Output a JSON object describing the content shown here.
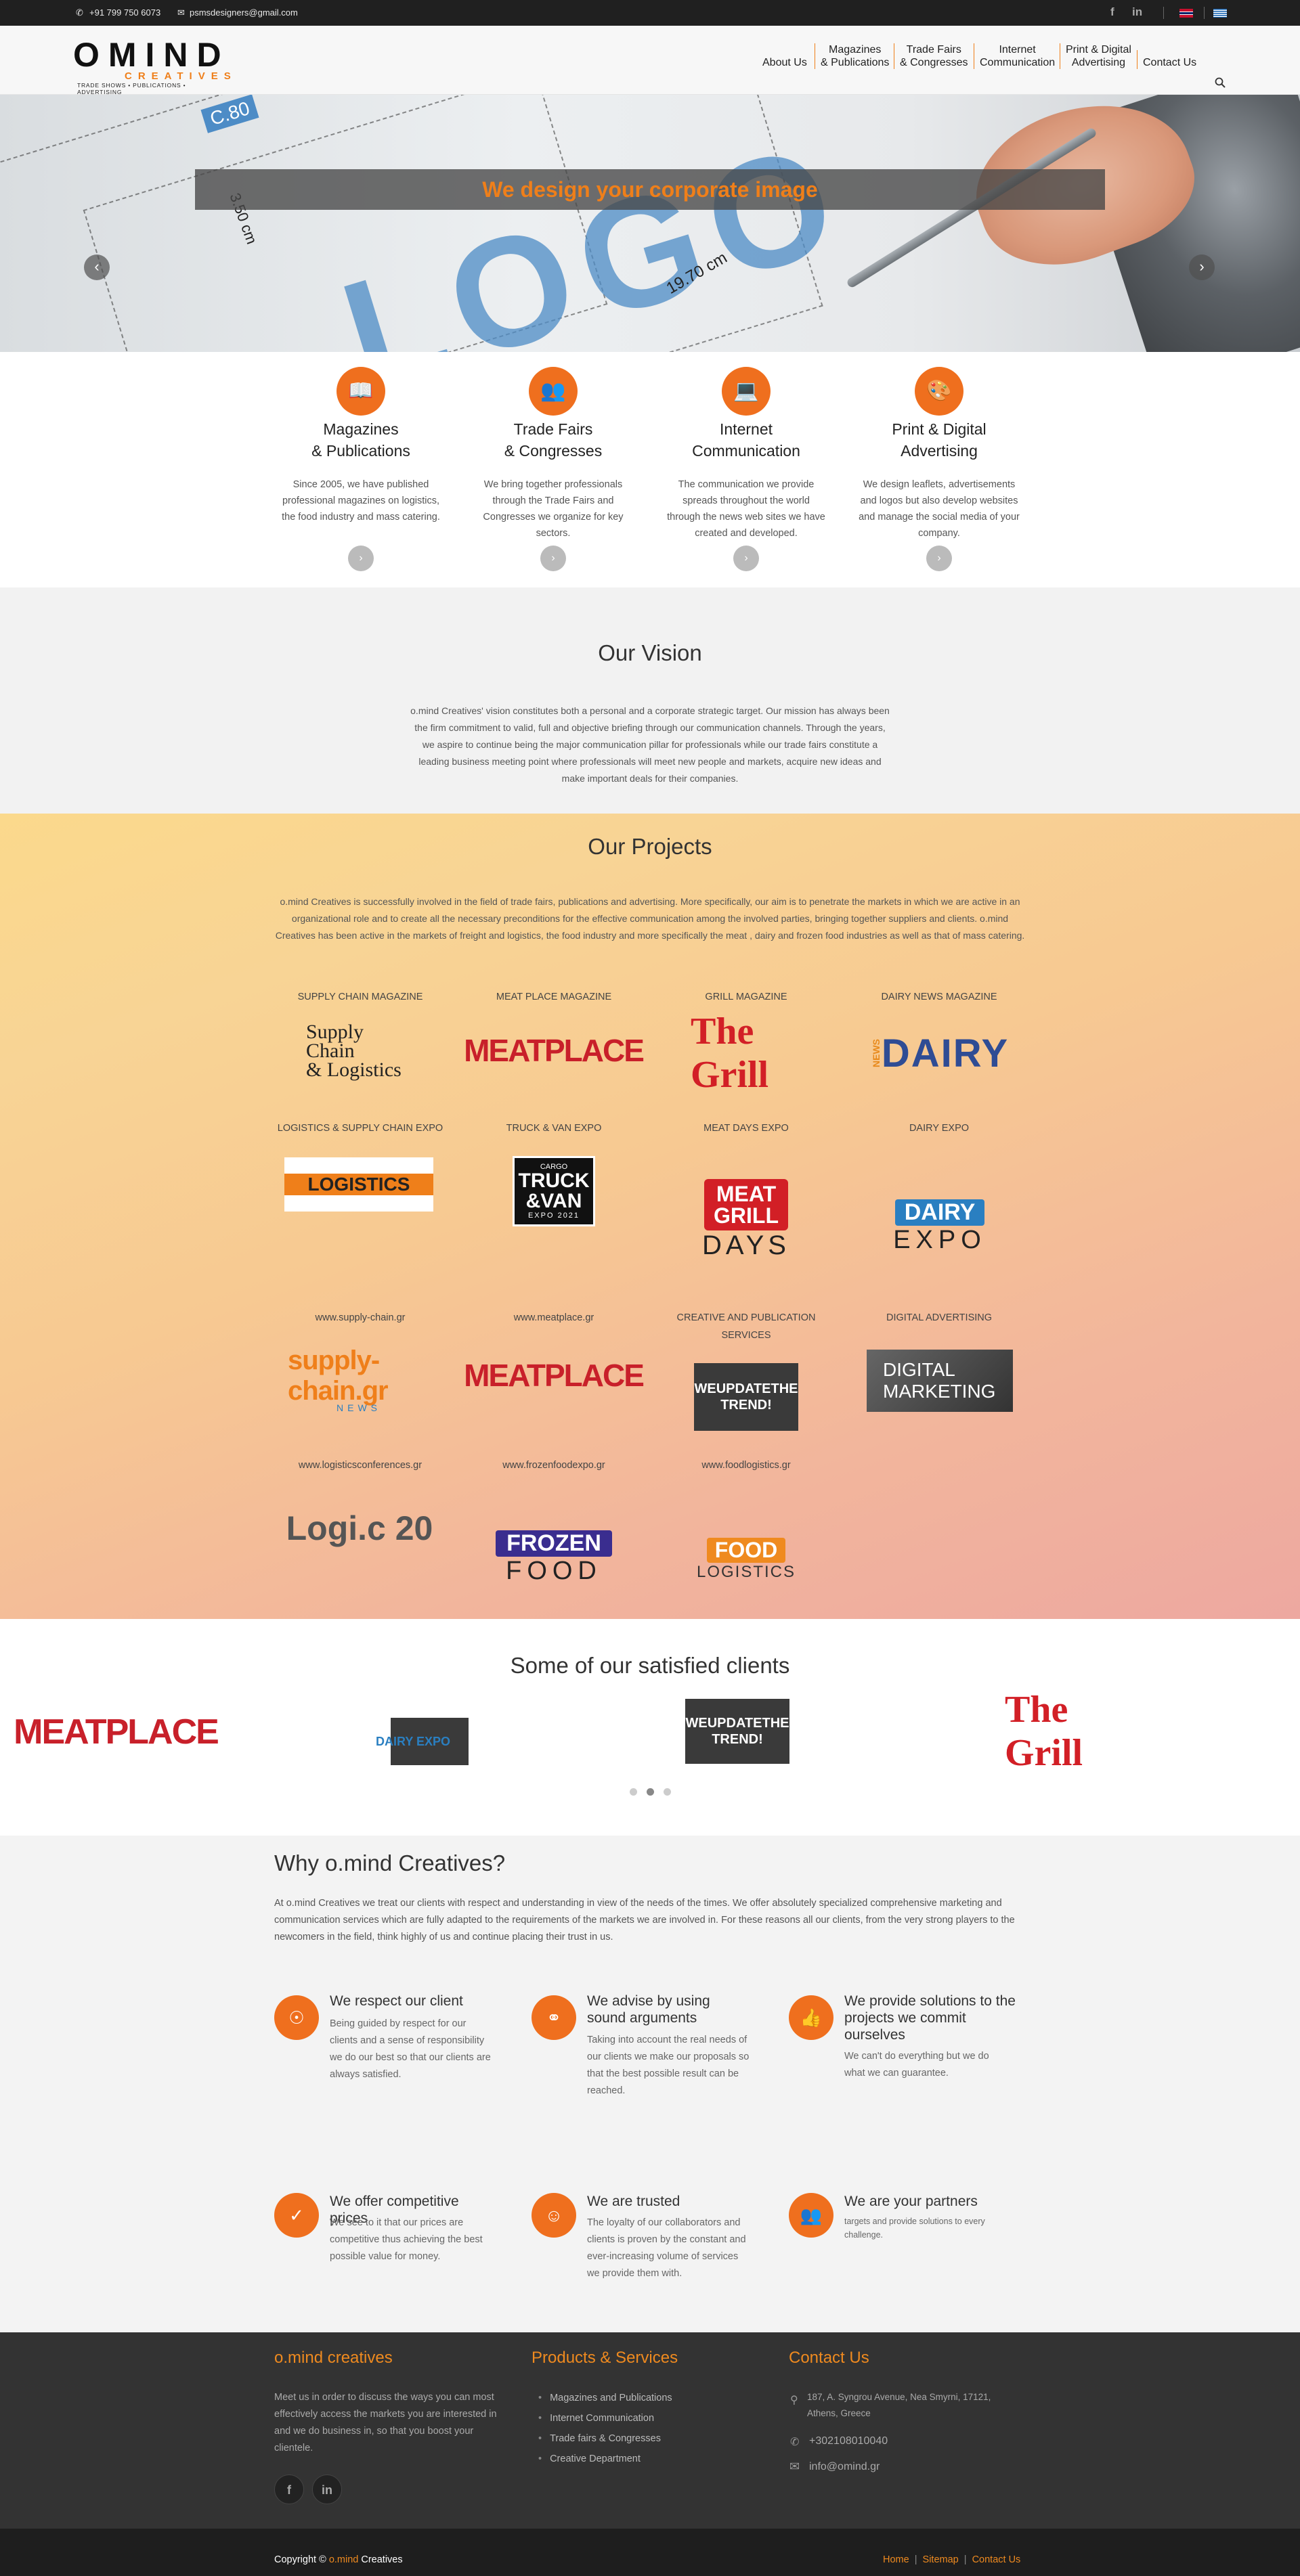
{
  "topbar": {
    "phone": "+91 799 750 6073",
    "email": "psmsdesigners@gmail.com",
    "social_fb": "f",
    "social_in": "in"
  },
  "header": {
    "logo_main": "OMIND",
    "logo_sub": "CREATIVES",
    "logo_tag": "TRADE SHOWS • PUBLICATIONS • ADVERTISING",
    "nav": [
      "About Us",
      "Magazines\n& Publications",
      "Trade Fairs\n& Congresses",
      "Internet\nCommunication",
      "Print & Digital\nAdvertising",
      "Contact Us"
    ]
  },
  "hero": {
    "headline": "We design your corporate image",
    "logo_text": "LOGO",
    "measure_1": "19.70 cm",
    "measure_2": "3.50 cm",
    "measure_3": "C.80"
  },
  "services": [
    {
      "title": "Magazines\n& Publications",
      "text": "Since 2005, we have published professional magazines on logistics, the food industry and mass catering.",
      "icon": "book-icon"
    },
    {
      "title": "Trade Fairs\n& Congresses",
      "text": "We bring together professionals through the Trade Fairs and Congresses we organize for key sectors.",
      "icon": "people-icon"
    },
    {
      "title": "Internet\nCommunication",
      "text": "The communication we provide spreads throughout the world through the news web sites we have created and developed.",
      "icon": "devices-icon"
    },
    {
      "title": "Print & Digital\nAdvertising",
      "text": "We design leaflets, advertisements and logos but also develop websites and manage the social media of your company.",
      "icon": "palette-icon"
    }
  ],
  "vision": {
    "title": "Our Vision",
    "text": "o.mind Creatives' vision constitutes both a personal and a corporate strategic target. Our mission has always been the firm commitment to valid, full and objective briefing through our communication channels. Through the years, we aspire to continue being the major communication pillar for professionals while our trade fairs constitute a leading business meeting point where professionals will meet new people and markets, acquire new ideas and make important deals for their companies."
  },
  "projects": {
    "title": "Our Projects",
    "text": "o.mind Creatives is successfully involved in the field of trade fairs, publications and advertising. More specifically, our aim is to penetrate the markets in which we are active in an organizational role and to create all the necessary preconditions for the effective communication among the involved parties, bringing together suppliers and clients. o.mind Creatives has been active in the markets of freight and logistics, the food industry and more specifically the meat , dairy and frozen food industries as well as that of mass catering.",
    "items": [
      {
        "label": "SUPPLY CHAIN MAGAZINE",
        "logo": "Supply Chain\n& Logistics"
      },
      {
        "label": "MEAT PLACE MAGAZINE",
        "logo": "MEATPLACE"
      },
      {
        "label": "GRILL MAGAZINE",
        "logo": "The Grill"
      },
      {
        "label": "DAIRY NEWS MAGAZINE",
        "logo": "DAIRY"
      },
      {
        "label": "LOGISTICS & SUPPLY CHAIN EXPO",
        "logo": "LOGISTICS"
      },
      {
        "label": "TRUCK & VAN EXPO",
        "logo": "TRUCK\n&VAN"
      },
      {
        "label": "MEAT DAYS EXPO",
        "logo": "MEAT\nGRILL"
      },
      {
        "label": "DAIRY EXPO",
        "logo": "DAIRY"
      },
      {
        "label": "www.supply-chain.gr",
        "logo": "supply-chain.gr"
      },
      {
        "label": "www.meatplace.gr",
        "logo": "MEATPLACE"
      },
      {
        "label": "CREATIVE AND PUBLICATION SERVICES",
        "logo": "WEUPDATETHE\nTREND!"
      },
      {
        "label": "DIGITAL ADVERTISING",
        "logo": "DIGITAL\nMARKETING"
      },
      {
        "label": "www.logisticsconferences.gr",
        "logo": "Logi.c 20"
      },
      {
        "label": "www.frozenfoodexpo.gr",
        "logo": "FROZEN"
      },
      {
        "label": "www.foodlogistics.gr",
        "logo": "FOOD"
      }
    ],
    "sub_texts": {
      "meat_days": "DAYS",
      "dairy_expo": "EXPO",
      "frozen_food": "FOOD",
      "food_logistics": "LOGISTICS",
      "supply_news": "NEWS",
      "truck_expo": "EXPO 2021",
      "truck_cargo": "CARGO",
      "dairy_news": "NEWS"
    }
  },
  "clients": {
    "title": "Some of our satisfied clients",
    "items": [
      "MEATPLACE",
      "DAIRY EXPO",
      "WEUPDATETHE TREND!",
      "The Grill"
    ]
  },
  "why": {
    "title": "Why o.mind Creatives?",
    "text": "At o.mind Creatives we treat our clients with respect and understanding in view of the needs of the times. We offer absolutely specialized comprehensive marketing and communication services which are fully adapted to the requirements of the markets we are involved in. For these reasons all our clients, from the very strong players to the newcomers in the field, think highly of us and continue placing their trust in us.",
    "items": [
      {
        "title": "We respect our client",
        "text": "Being guided by respect for our clients and a sense of responsibility we do our best so that our clients are always satisfied.",
        "icon": "compass-icon"
      },
      {
        "title": "We advise by using sound arguments",
        "text": "Taking into account the real needs of our clients we make our proposals so that the best possible result can be reached.",
        "icon": "share-icon"
      },
      {
        "title": "We provide solutions to the projects we commit ourselves",
        "text": "We can't do everything but we do what we can guarantee.",
        "icon": "thumbs-up-icon"
      },
      {
        "title": "We offer competitive prices",
        "text": "We see to it that our prices are competitive thus achieving the best possible value for money.",
        "icon": "check-icon"
      },
      {
        "title": "We are trusted",
        "text": "The loyalty of our collaborators and clients is proven by the constant and ever-increasing volume of services we provide them with.",
        "icon": "smile-icon"
      },
      {
        "title": "We are your partners",
        "text": "targets and provide solutions to every challenge.",
        "icon": "group-icon"
      }
    ]
  },
  "footer": {
    "col1_title": "o.mind creatives",
    "col1_text": "Meet us in order to discuss the ways you can most effectively access the markets you are interested in and we do business in, so that you boost your clientele.",
    "col2_title": "Products & Services",
    "col2_items": [
      "Magazines and Publications",
      "Internet Communication",
      "Trade fairs & Congresses",
      "Creative Department"
    ],
    "col3_title": "Contact Us",
    "address": "187, A. Syngrou Avenue, Nea Smyrni, 17121, Athens, Greece",
    "phone": "+302108010040",
    "email": "info@omind.gr",
    "fb": "f",
    "in": "in"
  },
  "copyright": {
    "prefix": "Copyright ©",
    "brand": "o.mind",
    "suffix": "Creatives",
    "links": [
      "Home",
      "Sitemap",
      "Contact Us"
    ]
  },
  "colors": {
    "accent": "#ef6f1e",
    "footer_title": "#ef8a1f",
    "footer_bg": "#333333"
  }
}
